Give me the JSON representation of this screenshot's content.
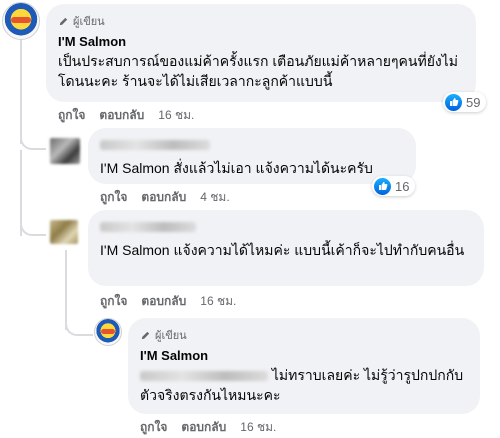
{
  "comments": [
    {
      "badge": "ผู้เขียน",
      "name": "I'M Salmon",
      "text": "เป็นประสบการณ์ของแม่ค้าครั้งแรก เตือนภัยแม่ค้าหลายๆคนที่ยังไม่โดนนะคะ ร้านจะได้ไม่เสียเวลากะลูกค้าแบบนี้",
      "like_label": "ถูกใจ",
      "reply_label": "ตอบกลับ",
      "time": "16 ชม.",
      "reactions": "59",
      "reaction_icon": "like-icon"
    },
    {
      "mention": "I'M Salmon",
      "text": " สั่งแล้วไม่เอา แจ้งความได้นะครับ",
      "like_label": "ถูกใจ",
      "reply_label": "ตอบกลับ",
      "time": "4 ชม.",
      "reactions": "16",
      "reaction_icon": "like-icon"
    },
    {
      "mention": "I'M Salmon",
      "text": " แจ้งความได้ไหมค่ะ แบบนี้เค้าก็จะไปทำกับคนอื่น",
      "like_label": "ถูกใจ",
      "reply_label": "ตอบกลับ",
      "time": "16 ชม."
    },
    {
      "badge": "ผู้เขียน",
      "name": "I'M Salmon",
      "text": " ไม่ทราบเลยค่ะ ไม่รู้ว่ารูปกปกกับตัวจริงตรงกันไหมนะคะ",
      "like_label": "ถูกใจ",
      "reply_label": "ตอบกลับ",
      "time": "16 ชม."
    }
  ],
  "colors": {
    "bubble": "#f0f2f5",
    "meta": "#65676b",
    "like_blue": "#1877f2"
  }
}
